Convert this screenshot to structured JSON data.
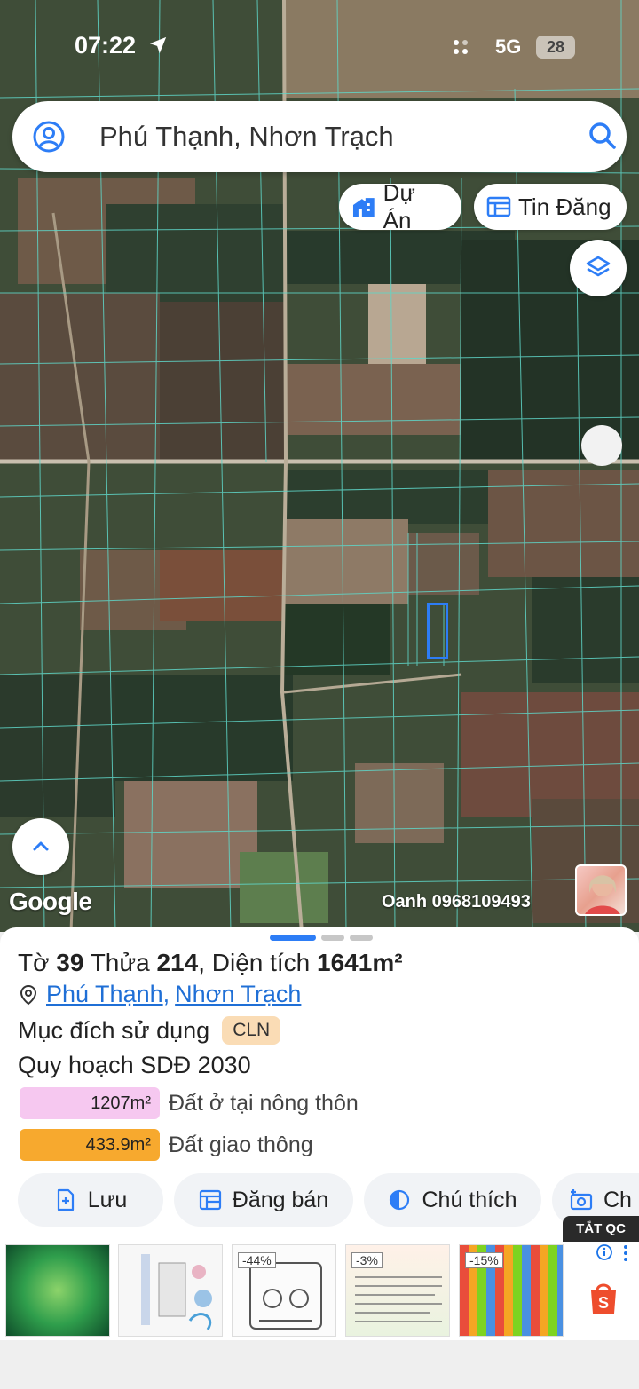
{
  "status_bar": {
    "time": "07:22",
    "network": "5G",
    "battery": "28"
  },
  "search": {
    "query": "Phú Thạnh, Nhơn Trạch"
  },
  "chips": {
    "du_an": "Dự Án",
    "tin_dang": "Tin Đăng"
  },
  "map": {
    "attribution": "Google",
    "watermark": "Oanh 0968109493",
    "highlight_color": "#2d7df6",
    "parcel_line_color": "#5fd6c8"
  },
  "parcel": {
    "sheet_label": "Tờ",
    "sheet_no": "39",
    "plot_label": "Thửa",
    "plot_no": "214",
    "area_label": "Diện tích",
    "area_value": "1641m²",
    "ward": "Phú Thạnh",
    "district": "Nhơn Trạch",
    "purpose_label": "Mục đích sử dụng",
    "purpose_code": "CLN",
    "plan_title": "Quy hoạch SDĐ 2030",
    "zones": [
      {
        "area": "1207m²",
        "label": "Đất ở tại nông thôn",
        "color": "#f6c8f0"
      },
      {
        "area": "433.9m²",
        "label": "Đất giao thông",
        "color": "#f7a92e"
      }
    ]
  },
  "actions": {
    "save": "Lưu",
    "post_for_sale": "Đăng bán",
    "legend": "Chú thích",
    "capture_partial": "Ch"
  },
  "ads": {
    "close_label": "TẮT QC",
    "discounts": [
      "-44%",
      "-3%",
      "-15%"
    ]
  }
}
